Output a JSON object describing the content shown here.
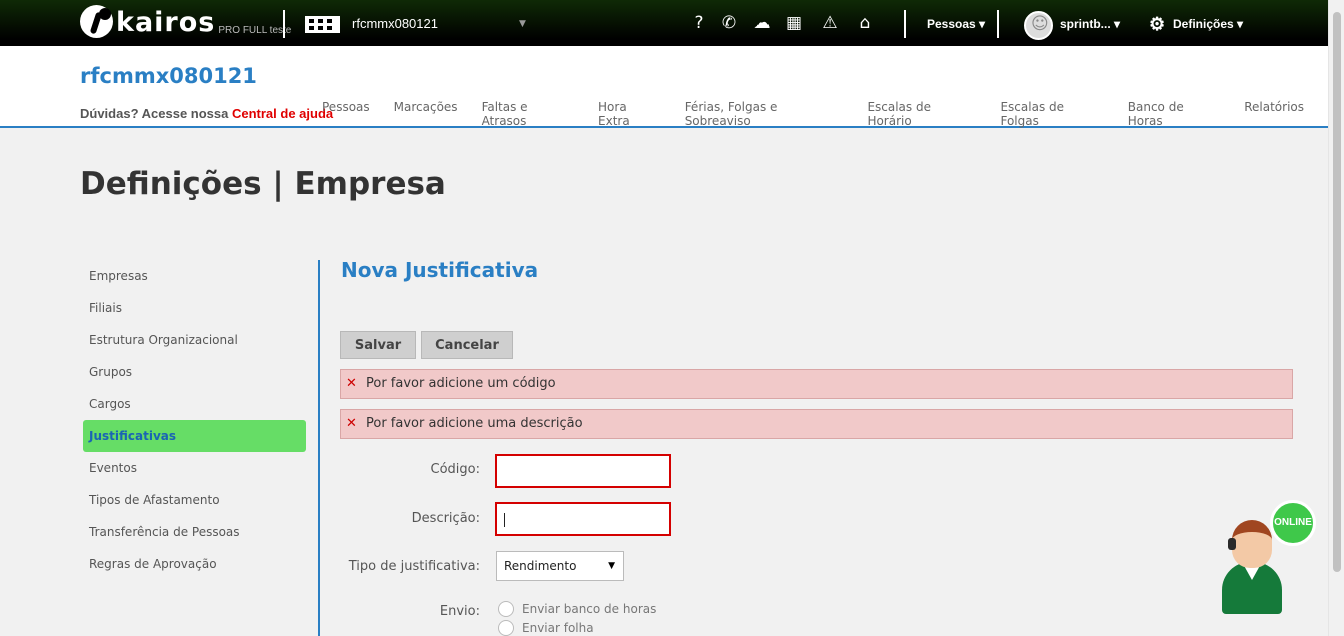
{
  "topbar": {
    "logo_text": "kairos",
    "logo_sub": "PRO FULL teste",
    "company": "rfcmmx080121",
    "icons": [
      "help-icon",
      "support-icon",
      "cloud-download-icon",
      "calculator-icon",
      "warning-icon",
      "inbox-icon"
    ],
    "icon_glyphs": [
      "?",
      "✆",
      "☁",
      "▦",
      "⚠",
      "⌂"
    ],
    "pessoas": "Pessoas",
    "user": "sprintb...",
    "definicoes": "Definições"
  },
  "header": {
    "title": "rfcmmx080121",
    "help_prefix": "Dúvidas? Acesse nossa ",
    "help_link": "Central de ajuda",
    "nav": [
      "Pessoas",
      "Marcações",
      "Faltas e Atrasos",
      "Hora Extra",
      "Férias, Folgas e Sobreaviso",
      "Escalas de Horário",
      "Escalas de Folgas",
      "Banco de Horas",
      "Relatórios"
    ]
  },
  "page": {
    "title": "Definições | Empresa"
  },
  "sidebar": {
    "items": [
      "Empresas",
      "Filiais",
      "Estrutura Organizacional",
      "Grupos",
      "Cargos",
      "Justificativas",
      "Eventos",
      "Tipos de Afastamento",
      "Transferência de Pessoas",
      "Regras de Aprovação"
    ],
    "active": "Justificativas"
  },
  "form": {
    "title": "Nova Justificativa",
    "save": "Salvar",
    "cancel": "Cancelar",
    "errors": [
      "Por favor adicione um código",
      "Por favor adicione uma descrição"
    ],
    "codigo_label": "Código:",
    "codigo_value": "",
    "descricao_label": "Descrição:",
    "descricao_value": "",
    "tipo_label": "Tipo de justificativa:",
    "tipo_value": "Rendimento",
    "envio_label": "Envio:",
    "envio_options": [
      "Enviar banco de horas",
      "Enviar folha"
    ]
  },
  "chat": {
    "badge": "ONLINE"
  },
  "colors": {
    "accent": "#2a7fc4",
    "active_item": "#66dd66",
    "error_bg": "#f1c9c9",
    "error_border": "#d40000"
  }
}
